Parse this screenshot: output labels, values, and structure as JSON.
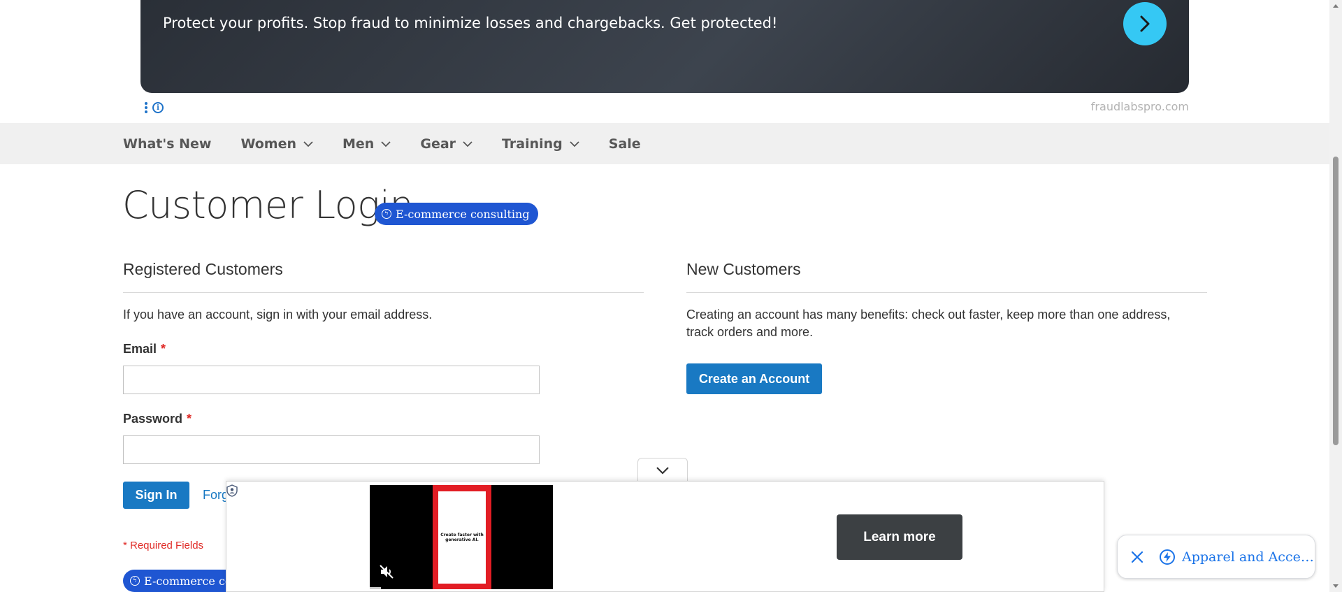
{
  "ad_banner": {
    "text": "Protect your profits. Stop fraud to minimize losses and chargebacks. Get protected!",
    "domain": "fraudlabspro.com",
    "arrow_color": "#35c8f4"
  },
  "nav": {
    "items": [
      {
        "label": "What's New",
        "has_dropdown": false
      },
      {
        "label": "Women",
        "has_dropdown": true
      },
      {
        "label": "Men",
        "has_dropdown": true
      },
      {
        "label": "Gear",
        "has_dropdown": true
      },
      {
        "label": "Training",
        "has_dropdown": true
      },
      {
        "label": "Sale",
        "has_dropdown": false
      }
    ]
  },
  "page": {
    "title": "Customer Login",
    "title_pill": "E-commerce consulting"
  },
  "registered": {
    "title": "Registered Customers",
    "intro": "If you have an account, sign in with your email address.",
    "email_label": "Email",
    "email_value": "",
    "password_label": "Password",
    "password_value": "",
    "required_marker": "*",
    "sign_in_label": "Sign In",
    "forgot_label": "Forg",
    "required_note": "* Required Fields",
    "bottom_pill": "E-commerce co"
  },
  "new_customers": {
    "title": "New Customers",
    "text": "Creating an account has many benefits: check out faster, keep more than one address, track orders and more.",
    "create_label": "Create an Account"
  },
  "bottom_ad": {
    "video_caption": "Create faster with generative AI.",
    "learn_more_label": "Learn more",
    "mute_icon": "muted-speaker-icon"
  },
  "chip": {
    "label": "Apparel and Acce…"
  },
  "colors": {
    "primary": "#1979c3",
    "required": "#e02b27",
    "pill": "#1f56d2",
    "nav_bg": "#f0f0f0"
  }
}
